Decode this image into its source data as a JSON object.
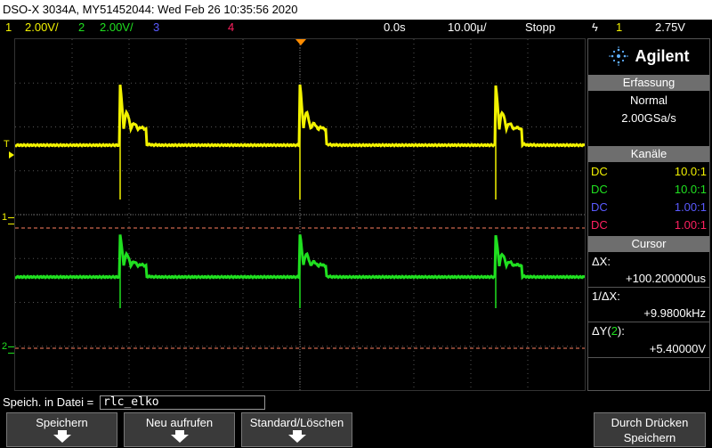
{
  "window": {
    "title": "DSO-X 3034A, MY51452044: Wed Feb 26 10:35:56 2020"
  },
  "status": {
    "ch1": {
      "num": "1",
      "scale": "2.00V/",
      "color": "#f2f200"
    },
    "ch2": {
      "num": "2",
      "scale": "2.00V/",
      "color": "#20e020"
    },
    "ch3": {
      "num": "3",
      "color": "#5a5aff"
    },
    "ch4": {
      "num": "4",
      "color": "#ff2060"
    },
    "time_offset": "0.0s",
    "time_scale": "10.00µ/",
    "run_state": "Stopp",
    "trigger_symbol": "ϟ",
    "trigger_source": "1",
    "trigger_level": "2.75V"
  },
  "brand": {
    "name": "Agilent",
    "icon": "agilent-spark-icon"
  },
  "acquisition": {
    "header": "Erfassung",
    "mode": "Normal",
    "rate": "2.00GSa/s"
  },
  "channels": {
    "header": "Kanäle",
    "rows": [
      {
        "coupling": "DC",
        "probe": "10.0:1",
        "color": "#f2f200"
      },
      {
        "coupling": "DC",
        "probe": "10.0:1",
        "color": "#20e020"
      },
      {
        "coupling": "DC",
        "probe": "1.00:1",
        "color": "#5a5aff"
      },
      {
        "coupling": "DC",
        "probe": "1.00:1",
        "color": "#ff2060"
      }
    ]
  },
  "cursor": {
    "header": "Cursor",
    "dx_label": "ΔX:",
    "dx_value": "+100.200000us",
    "inv_label": "1/ΔX:",
    "inv_value": "+9.9800kHz",
    "dy_label_pre": "ΔY(",
    "dy_label_ch": "2",
    "dy_label_post": "):",
    "dy_value": "+5.40000V"
  },
  "markers": {
    "trigger": "T",
    "ch1": "1",
    "ch2": "2"
  },
  "file": {
    "label": "Speich. in Datei =",
    "value": "rlc_elko"
  },
  "softkeys": [
    {
      "label": "Speichern",
      "label2": ""
    },
    {
      "label": "Neu aufrufen",
      "label2": ""
    },
    {
      "label": "Standard/Löschen",
      "label2": ""
    },
    {
      "label": "Durch Drücken",
      "label2": "Speichern"
    }
  ],
  "colors": {
    "ch1": "#f2f200",
    "ch2": "#20e020",
    "cursor": "#ff8060",
    "grid": "#555555",
    "panel_header": "#6e6e6e"
  }
}
